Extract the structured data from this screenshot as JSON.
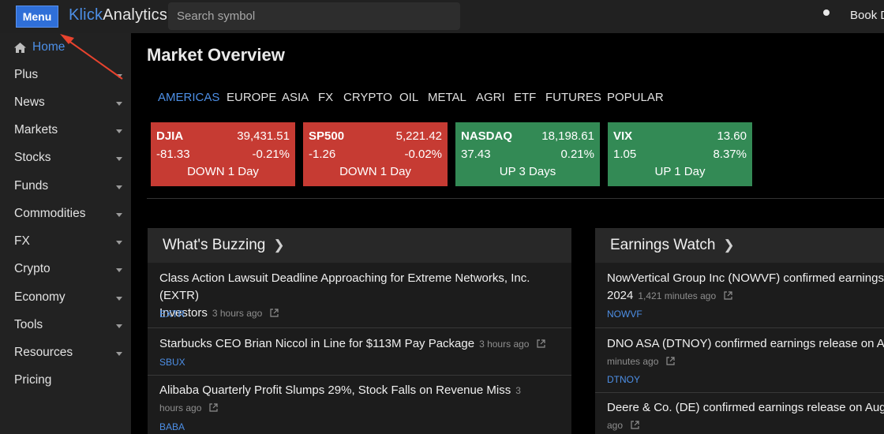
{
  "header": {
    "menu_label": "Menu",
    "logo_part1": "Klick",
    "logo_part2": "Analytics",
    "search_placeholder": "Search symbol",
    "right_label": "Book D"
  },
  "sidebar": {
    "items": [
      {
        "label": "Home"
      },
      {
        "label": "Plus"
      },
      {
        "label": "News"
      },
      {
        "label": "Markets"
      },
      {
        "label": "Stocks"
      },
      {
        "label": "Funds"
      },
      {
        "label": "Commodities"
      },
      {
        "label": "FX"
      },
      {
        "label": "Crypto"
      },
      {
        "label": "Economy"
      },
      {
        "label": "Tools"
      },
      {
        "label": "Resources"
      },
      {
        "label": "Pricing"
      }
    ]
  },
  "main": {
    "title": "Market Overview",
    "tabs": [
      "AMERICAS",
      "EUROPE",
      "ASIA",
      "FX",
      "CRYPTO",
      "OIL",
      "METAL",
      "AGRI",
      "ETF",
      "FUTURES",
      "POPULAR"
    ],
    "active_tab": "AMERICAS",
    "cards": [
      {
        "symbol": "DJIA",
        "price": "39,431.51",
        "change": "-81.33",
        "pct": "-0.21%",
        "trend": "DOWN 1 Day",
        "status": "down"
      },
      {
        "symbol": "SP500",
        "price": "5,221.42",
        "change": "-1.26",
        "pct": "-0.02%",
        "trend": "DOWN 1 Day",
        "status": "down"
      },
      {
        "symbol": "NASDAQ",
        "price": "18,198.61",
        "change": "37.43",
        "pct": "0.21%",
        "trend": "UP 3 Days",
        "status": "up"
      },
      {
        "symbol": "VIX",
        "price": "13.60",
        "change": "1.05",
        "pct": "8.37%",
        "trend": "UP 1 Day",
        "status": "up"
      }
    ],
    "colors": {
      "down": "#c63b33",
      "up": "#338a55",
      "accent": "#4d8fe6",
      "annotation": "#e8432e"
    }
  },
  "buzzing": {
    "title": "What's Buzzing",
    "items": [
      {
        "line1": "Class Action Lawsuit Deadline Approaching for Extreme Networks, Inc. (EXTR)",
        "line2": "Investors",
        "time": "3 hours ago",
        "ticker": "EXTR"
      },
      {
        "line1": "Starbucks CEO Brian Niccol in Line for $113M Pay Package",
        "line2": "",
        "time": "3 hours ago",
        "ticker": "SBUX"
      },
      {
        "line1": "Alibaba Quarterly Profit Slumps 29%, Stock Falls on Revenue Miss",
        "line2": "",
        "time": "3 hours ago",
        "ticker": "BABA"
      }
    ]
  },
  "earnings": {
    "title": "Earnings Watch",
    "items": [
      {
        "line1": "NowVertical Group Inc (NOWVF) confirmed earnings re",
        "line2": "2024",
        "time": "1,421 minutes ago",
        "ticker": "NOWVF"
      },
      {
        "line1": "DNO ASA (DTNOY) confirmed earnings release on Aug",
        "line2": "minutes ago",
        "ticker": "DTNOY"
      },
      {
        "line1": "Deere & Co. (DE) confirmed earnings release on Augus",
        "line2": "ago"
      }
    ]
  },
  "icons": {
    "home": "home-icon",
    "caret": "caret-down-icon",
    "chevron": "chevron-right-icon",
    "external": "external-link-icon"
  }
}
